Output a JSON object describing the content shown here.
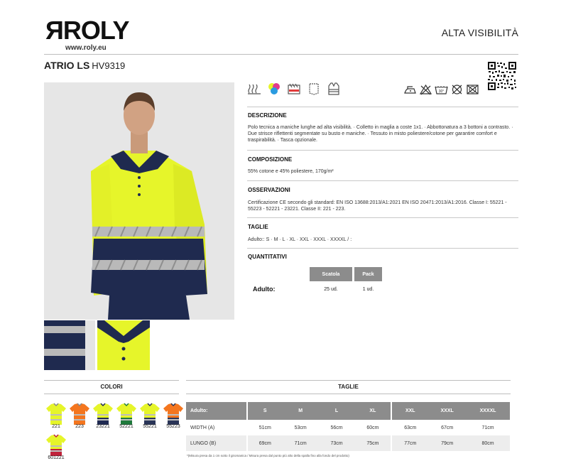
{
  "header": {
    "site": "www.roly.eu",
    "category": "ALTA VISIBILITÀ",
    "product_name": "ATRIO LS",
    "product_code": "HV9319"
  },
  "sections": {
    "description": {
      "title": "DESCRIZIONE",
      "text": "Polo tecnica a maniche lunghe ad alta visibilità. · Colletto in maglia a coste 1x1. · Abbottonatura a 3 bottoni a contrasto. · Due strisce riflettenti segmentate su busto e maniche. · Tessuto in misto poliestere/cotone per garantire comfort e traspirabilità. · Tasca opzionale."
    },
    "composition": {
      "title": "COMPOSIZIONE",
      "text": "55% cotone e 45% poliestere, 170g/m²"
    },
    "observations": {
      "title": "OSSERVAZIONI",
      "text": "Certificazione CE secondo gli standard: EN ISO 13688:2013/A1:2021 EN ISO 20471:2013/A1:2016. Classe I: 55221 - 55223 - 52221 - 23221. Classe II: 221 - 223."
    },
    "sizes": {
      "title": "TAGLIE",
      "text": "Adulto:: S · M · L · XL · XXL · XXXL · XXXXL / :"
    },
    "quantities": {
      "title": "QUANTITATIVI",
      "headers": [
        "Scatola",
        "Pack"
      ],
      "row_label": "Adulto:",
      "values": [
        "25 ud.",
        "1 ud."
      ]
    }
  },
  "colors": {
    "title": "COLORI",
    "items": [
      {
        "code": "221",
        "body": "#e6f52a",
        "band": "#e6f52a"
      },
      {
        "code": "223",
        "body": "#f4761f",
        "band": "#f4761f"
      },
      {
        "code": "23221",
        "body": "#e6f52a",
        "band": "#1f2a52"
      },
      {
        "code": "52221",
        "body": "#e6f52a",
        "band": "#1f7a3c"
      },
      {
        "code": "55221",
        "body": "#e6f52a",
        "band": "#2a3558"
      },
      {
        "code": "55223",
        "body": "#f4761f",
        "band": "#2a3558"
      },
      {
        "code": "601221",
        "body": "#e6f52a",
        "band": "#c0223a"
      }
    ]
  },
  "size_table": {
    "title": "TAGLIE",
    "header": [
      "Adulto:",
      "S",
      "M",
      "L",
      "XL",
      "XXL",
      "XXXL",
      "XXXXL"
    ],
    "rows": [
      [
        "WIDTH (A)",
        "51cm",
        "53cm",
        "56cm",
        "60cm",
        "63cm",
        "67cm",
        "71cm"
      ],
      [
        "LUNGO (B)",
        "69cm",
        "71cm",
        "73cm",
        "75cm",
        "77cm",
        "79cm",
        "80cm"
      ]
    ],
    "footnote": "*(Misura presa da 1 cm sotto il giromanica / Misura presa dal punto più alto della spalla fino alla fondo del prodotto)"
  },
  "brand": {
    "hi_vis_yellow": "#e6f52a",
    "navy": "#1f2a4f",
    "header_gray": "#8c8c8c"
  },
  "icons": [
    "fabric-icon",
    "color-range-icon",
    "reflective-icon",
    "pocket-icon",
    "hi-vis-vest-icon",
    "iron-icon",
    "no-bleach-icon",
    "wash-30-icon",
    "no-dryclean-icon",
    "no-tumble-dry-icon",
    "qr-code-icon"
  ]
}
